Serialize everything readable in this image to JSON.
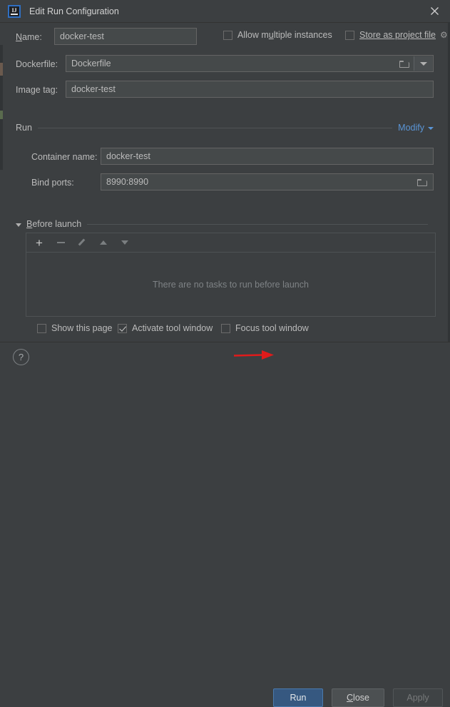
{
  "window": {
    "title": "Edit Run Configuration",
    "app_icon": "intellij-idea-logo",
    "close_icon": "✕"
  },
  "top_form": {
    "name_label": "Name:",
    "name_mnemonic": "N",
    "name_value": "docker-test",
    "allow_multiple_instances": {
      "label_before": "Allow m",
      "label_mnemonic": "u",
      "label_after": "ltiple instances",
      "checked": false
    },
    "store_as_project_file": {
      "label": "Store as project file",
      "checked": false,
      "gear_icon": "⚙"
    }
  },
  "dockerfile": {
    "label": "Dockerfile:",
    "value": "Dockerfile",
    "browse_icon": "folder-icon",
    "dropdown_icon": "chevron-down-icon"
  },
  "image_tag": {
    "label": "Image tag:",
    "value": "docker-test"
  },
  "run_group": {
    "title": "Run",
    "modify_label": "Modify",
    "container_name": {
      "label": "Container name:",
      "value": "docker-test"
    },
    "bind_ports": {
      "label": "Bind ports:",
      "value": "8990:8990",
      "browse_icon": "folder-icon"
    }
  },
  "before_launch": {
    "title": "Before launch",
    "title_mnemonic": "B",
    "expanded": true,
    "toolbar": [
      {
        "name": "add-task-button",
        "icon": "plus-icon",
        "label": "+",
        "enabled": true
      },
      {
        "name": "remove-task-button",
        "icon": "minus-icon",
        "label": "−",
        "enabled": false
      },
      {
        "name": "edit-task-button",
        "icon": "pencil-icon",
        "label": "Edit",
        "enabled": false
      },
      {
        "name": "move-up-button",
        "icon": "arrow-up-icon",
        "label": "Up",
        "enabled": false
      },
      {
        "name": "move-down-button",
        "icon": "arrow-down-icon",
        "label": "Down",
        "enabled": false
      }
    ],
    "empty_message": "There are no tasks to run before launch"
  },
  "options": [
    {
      "name": "show-this-page",
      "label": "Show this page",
      "checked": false
    },
    {
      "name": "activate-tool-window",
      "label": "Activate tool window",
      "checked": true
    },
    {
      "name": "focus-tool-window",
      "label": "Focus tool window",
      "checked": false
    }
  ],
  "footer": {
    "help_label": "?",
    "run_label": "Run",
    "close_label": "Close",
    "close_mnemonic": "C",
    "apply_label": "Apply",
    "apply_enabled": false
  },
  "annotation": {
    "arrow_color": "#e01b1b",
    "points_to": "run-button"
  },
  "colors": {
    "dialog_bg": "#3c3f41",
    "field_bg": "#45494a",
    "accent_link": "#5a95d6",
    "primary_button": "#365880",
    "annotation_red": "#e01b1b"
  }
}
